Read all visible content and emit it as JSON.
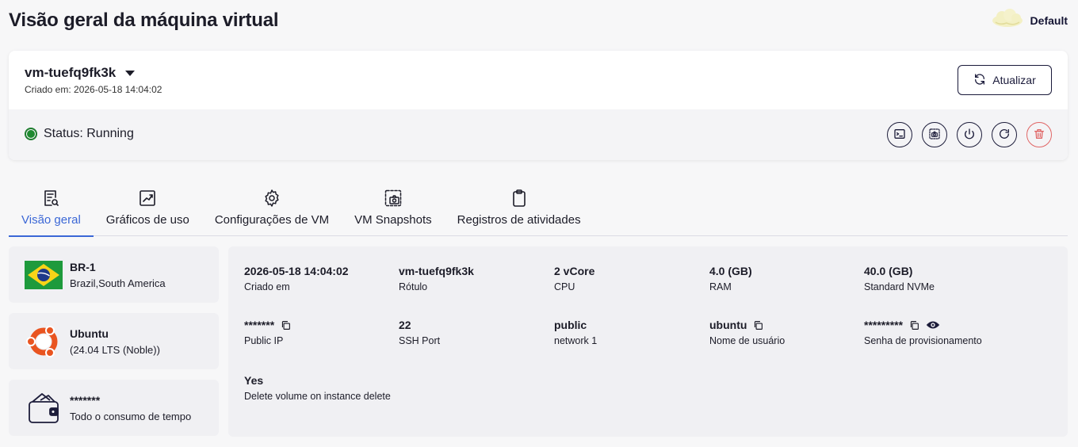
{
  "page": {
    "title": "Visão geral da máquina virtual"
  },
  "workspace": {
    "name": "Default"
  },
  "vm": {
    "name": "vm-tuefq9fk3k",
    "created": "Criado em: 2026-05-18 14:04:02",
    "refresh_label": "Atualizar",
    "status": "Status: Running",
    "status_color": "#1e8a30"
  },
  "actions": [
    {
      "icon": "console-icon"
    },
    {
      "icon": "snapshot-icon"
    },
    {
      "icon": "power-icon"
    },
    {
      "icon": "restart-icon"
    },
    {
      "icon": "trash-icon",
      "color": "#e06565"
    }
  ],
  "tabs": [
    {
      "label": "Visão geral",
      "icon": "overview-icon",
      "active": true
    },
    {
      "label": "Gráficos de uso",
      "icon": "chart-icon"
    },
    {
      "label": "Configurações de VM",
      "icon": "gear-icon"
    },
    {
      "label": "VM Snapshots",
      "icon": "snapshot-icon"
    },
    {
      "label": "Registros de atividades",
      "icon": "clipboard-icon"
    }
  ],
  "location": {
    "title": "BR-1",
    "subtitle": "Brazil,South America"
  },
  "os": {
    "title": "Ubuntu",
    "subtitle": "(24.04 LTS (Noble))"
  },
  "billing": {
    "title": "*******",
    "subtitle": "Todo o consumo de tempo"
  },
  "details": {
    "created": {
      "value": "2026-05-18 14:04:02",
      "label": "Criado em"
    },
    "name": {
      "value": "vm-tuefq9fk3k",
      "label": "Rótulo"
    },
    "cpu": {
      "value": "2 vCore",
      "label": "CPU"
    },
    "ram": {
      "value": "4.0 (GB)",
      "label": "RAM"
    },
    "storage": {
      "value": "40.0 (GB)",
      "label": "Standard NVMe"
    },
    "public_ip": {
      "value": "*******",
      "label": "Public IP"
    },
    "ssh_port": {
      "value": "22",
      "label": "SSH Port"
    },
    "network": {
      "value": "public",
      "label": "network 1"
    },
    "username": {
      "value": "ubuntu",
      "label": "Nome de usuário"
    },
    "password": {
      "value": "*********",
      "label": "Senha de provisionamento"
    },
    "delete_volume": {
      "value": "Yes",
      "label": "Delete volume on instance delete"
    }
  },
  "colors": {
    "accent": "#3b67d6",
    "card_bg": "#f0f0f3"
  }
}
